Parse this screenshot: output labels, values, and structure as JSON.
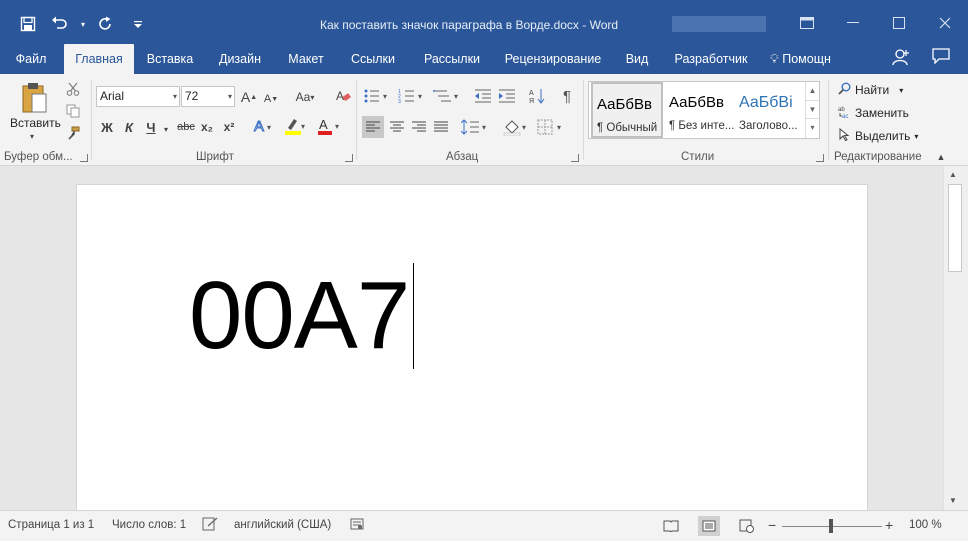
{
  "window": {
    "title": "Как поставить значок параграфа в Ворде.docx - Word"
  },
  "qat": {
    "save_icon": "save-icon",
    "undo_icon": "undo-icon",
    "redo_icon": "redo-icon",
    "customize_icon": "customize-qat-icon"
  },
  "tabs": [
    {
      "label": "Файл"
    },
    {
      "label": "Главная"
    },
    {
      "label": "Вставка"
    },
    {
      "label": "Дизайн"
    },
    {
      "label": "Макет"
    },
    {
      "label": "Ссылки"
    },
    {
      "label": "Рассылки"
    },
    {
      "label": "Рецензирование"
    },
    {
      "label": "Вид"
    },
    {
      "label": "Разработчик"
    }
  ],
  "tell_me": "Помощн",
  "ribbon": {
    "clipboard": {
      "paste_label": "Вставить",
      "group_label": "Буфер обм..."
    },
    "font": {
      "font_name": "Arial",
      "font_size": "72",
      "group_label": "Шрифт",
      "bold": "Ж",
      "italic": "К",
      "underline": "Ч",
      "strike": "abc",
      "subscript": "x₂",
      "superscript": "x²",
      "grow": "A",
      "shrink": "A",
      "case": "Aa"
    },
    "paragraph": {
      "group_label": "Абзац",
      "pilcrow": "¶"
    },
    "styles": {
      "group_label": "Стили",
      "items": [
        {
          "sample": "АаБбВв",
          "name": "¶ Обычный"
        },
        {
          "sample": "АаБбВв",
          "name": "¶ Без инте..."
        },
        {
          "sample": "АаБбВі",
          "name": "Заголово..."
        }
      ]
    },
    "editing": {
      "group_label": "Редактирование",
      "find": "Найти",
      "replace": "Заменить",
      "select": "Выделить"
    }
  },
  "document": {
    "text": "00A7"
  },
  "statusbar": {
    "page": "Страница 1 из 1",
    "words": "Число слов: 1",
    "language": "английский (США)",
    "zoom": "100 %",
    "zoom_percent": 100
  },
  "colors": {
    "accent": "#2b579a",
    "ribbon_bg": "#f3f3f3"
  }
}
